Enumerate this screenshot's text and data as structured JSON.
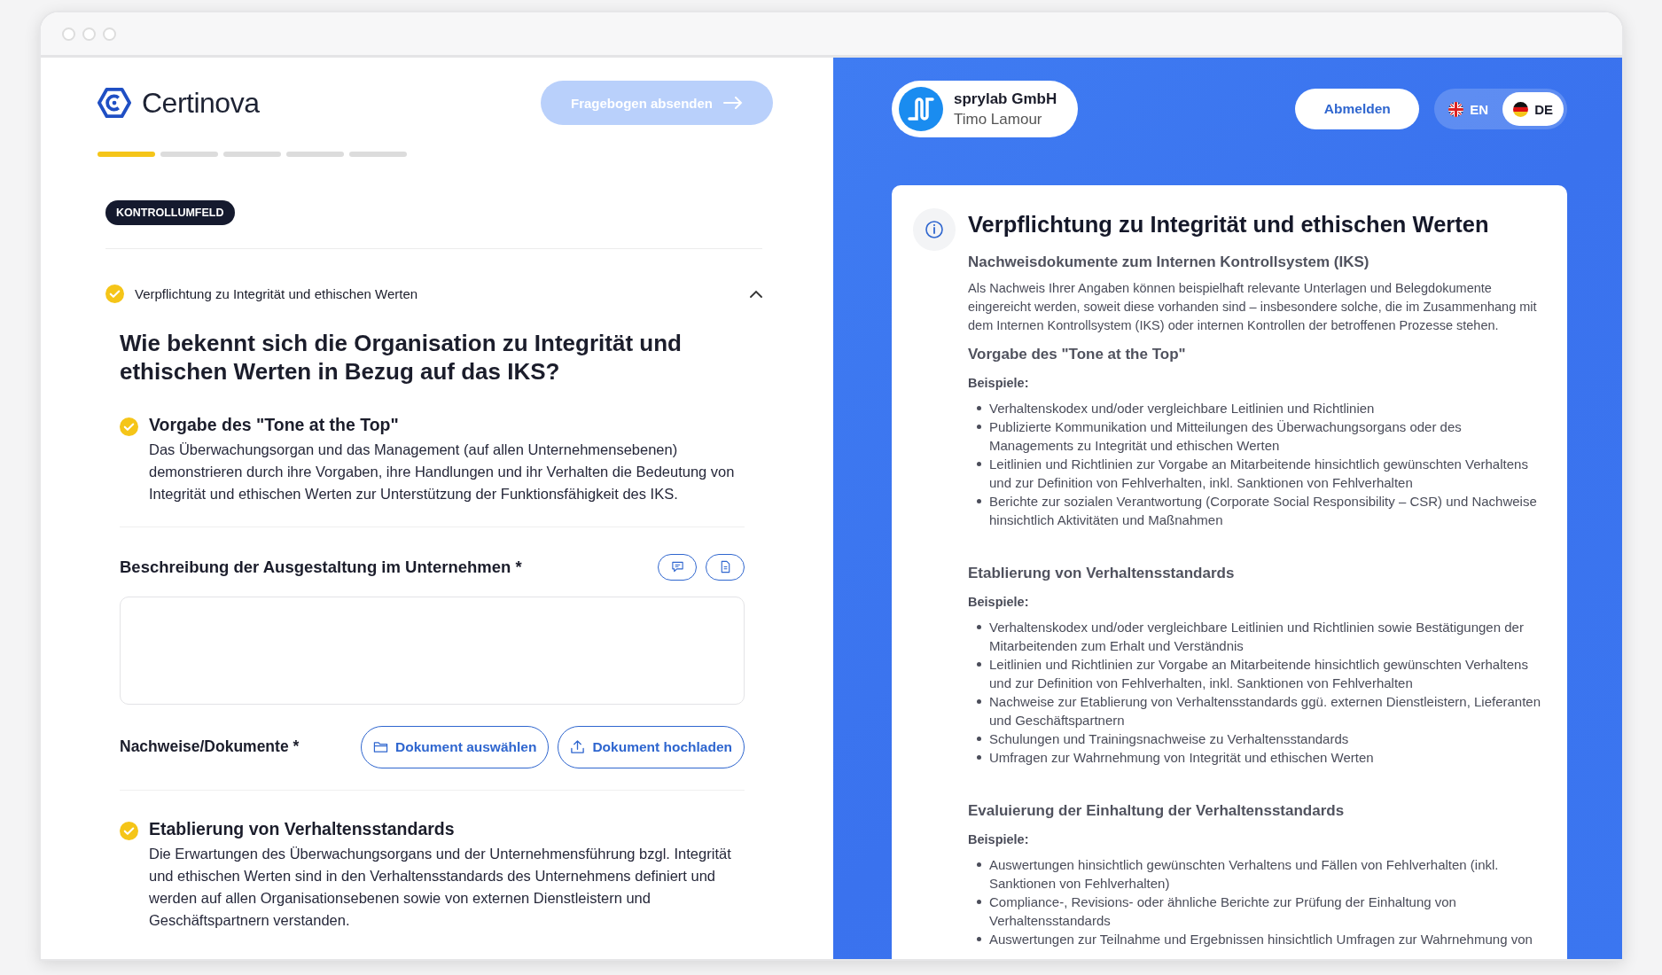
{
  "left": {
    "logo": {
      "name": "Certinova"
    },
    "submit_button": {
      "label": "Fragebogen absenden",
      "disabled": true
    },
    "progress_steps": [
      {
        "completed": true
      },
      {
        "completed": false
      },
      {
        "completed": false
      },
      {
        "completed": false
      },
      {
        "completed": false
      }
    ],
    "category_badge": "KONTROLLUMFELD",
    "section": {
      "title": "Verpflichtung zu Integrität und ethischen Werten",
      "completed": true,
      "expanded": true,
      "question": "Wie bekennt sich die Organisation zu Integrität und ethischen Werten in Bezug auf das IKS?",
      "items": [
        {
          "kind": "principle",
          "title": "Vorgabe des \"Tone at the Top\"",
          "completed": true,
          "text": "Das Überwachungsorgan und das Management (auf allen Unternehmensebenen) demonstrieren durch ihre Vorgaben, ihre Handlungen und ihr Verhalten die Bedeutung von Integrität und ethischen Werten zur Unterstützung der Funktionsfähigkeit des IKS."
        },
        {
          "kind": "form",
          "description_label": "Beschreibung der Ausgestaltung im Unternehmen *",
          "documents_label": "Nachweise/Dokumente *",
          "buttons": [
            {
              "kind": "select",
              "label": "Dokument auswählen"
            },
            {
              "kind": "upload",
              "label": "Dokument hochladen"
            }
          ]
        },
        {
          "kind": "principle",
          "title": "Etablierung von Verhaltensstandards",
          "completed": true,
          "text": "Die Erwartungen des Überwachungsorgans und der Unternehmensführung bzgl. Integrität und ethischen Werten sind in den Verhaltensstandards des Unternehmens definiert und werden auf allen Organisationsebenen sowie von externen Dienstleistern und Geschäftspartnern verstanden."
        }
      ]
    }
  },
  "right": {
    "company": {
      "name": "sprylab GmbH",
      "user": "Timo Lamour"
    },
    "logout_button": "Abmelden",
    "languages": [
      {
        "kind": "uk",
        "code": "EN",
        "selected": false
      },
      {
        "kind": "de",
        "code": "DE",
        "selected": true
      }
    ],
    "info": {
      "title": "Verpflichtung zu Integrität und ethischen Werten",
      "subtitle": "Nachweisdokumente zum Internen Kontrollsystem (IKS)",
      "intro": "Als Nachweis Ihrer Angaben können beispielhaft relevante Unterlagen und Belegdokumente eingereicht werden, soweit diese vorhanden sind – insbesondere solche, die im Zusammenhang mit dem Internen Kontrollsystem (IKS) oder internen Kontrollen der betroffenen Prozesse stehen.",
      "sections": [
        {
          "heading": "Vorgabe des \"Tone at the Top\"",
          "label": "Beispiele:",
          "examples": [
            "Verhaltenskodex und/oder vergleichbare Leitlinien und Richtlinien",
            "Publizierte Kommunikation und Mitteilungen des Überwachungsorgans oder des Managements zu Integrität und ethischen Werten",
            "Leitlinien und Richtlinien zur Vorgabe an Mitarbeitende hinsichtlich gewünschten Verhaltens und zur Definition von Fehlverhalten, inkl. Sanktionen von Fehlverhalten",
            "Berichte zur sozialen Verantwortung (Corporate Social Responsibility – CSR) und Nachweise hinsichtlich Aktivitäten und Maßnahmen"
          ]
        },
        {
          "heading": "Etablierung von Verhaltensstandards",
          "label": "Beispiele:",
          "examples": [
            "Verhaltenskodex und/oder vergleichbare Leitlinien und Richtlinien sowie Bestätigungen der Mitarbeitenden zum Erhalt und Verständnis",
            "Leitlinien und Richtlinien zur Vorgabe an Mitarbeitende hinsichtlich gewünschten Verhaltens und zur Definition von Fehlverhalten, inkl. Sanktionen von Fehlverhalten",
            "Nachweise zur Etablierung von Verhaltensstandards ggü. externen Dienstleistern, Lieferanten und Geschäftspartnern",
            "Schulungen und Trainingsnachweise zu Verhaltensstandards",
            "Umfragen zur Wahrnehmung von Integrität und ethischen Werten"
          ]
        },
        {
          "heading": "Evaluierung der Einhaltung der Verhaltensstandards",
          "label": "Beispiele:",
          "examples": [
            "Auswertungen hinsichtlich gewünschten Verhaltens und Fällen von Fehlverhalten (inkl. Sanktionen von Fehlverhalten)",
            "Compliance-, Revisions- oder ähnliche Berichte zur Prüfung der Einhaltung von Verhaltensstandards",
            "Auswertungen zur Teilnahme und Ergebnissen hinsichtlich Umfragen zur Wahrnehmung von"
          ]
        }
      ]
    }
  }
}
